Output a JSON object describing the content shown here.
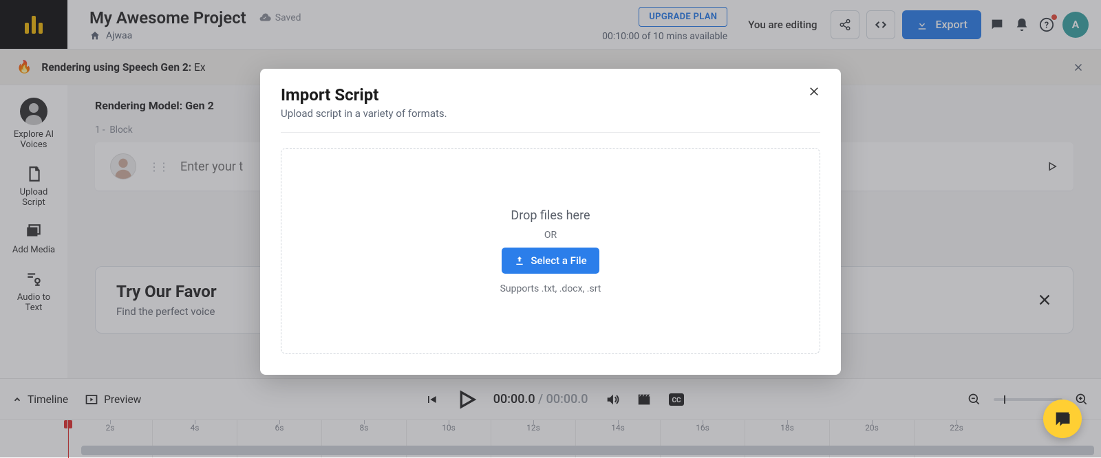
{
  "header": {
    "project_title": "My Awesome Project",
    "saved_label": "Saved",
    "home_label": "Ajwaa",
    "upgrade_label": "UPGRADE PLAN",
    "time_available": "00:10:00 of 10 mins available",
    "editing_label": "You are editing",
    "export_label": "Export",
    "avatar_letter": "A"
  },
  "banner": {
    "text_strong": "Rendering using Speech Gen 2:",
    "text_rest": " Ex"
  },
  "rail": {
    "explore": "Explore AI\nVoices",
    "upload": "Upload\nScript",
    "add_media": "Add Media",
    "audio_text": "Audio to\nText"
  },
  "main": {
    "model_label": "Rendering Model: Gen 2",
    "block_label_num": "1 -",
    "block_label_text": "Block",
    "input_placeholder": "Enter your t"
  },
  "favorites": {
    "title": "Try Our Favor",
    "subtitle": "Find the perfect voice"
  },
  "transport": {
    "timeline_label": "Timeline",
    "preview_label": "Preview",
    "time_current": "00:00.0",
    "time_sep": " / ",
    "time_total": "00:00.0",
    "ticks": [
      "2s",
      "4s",
      "6s",
      "8s",
      "10s",
      "12s",
      "14s",
      "16s",
      "18s",
      "20s",
      "22s"
    ]
  },
  "modal": {
    "title": "Import Script",
    "subtitle": "Upload script in a variety of formats.",
    "drop_title": "Drop files here",
    "or": "OR",
    "select_label": "Select a File",
    "supports": "Supports .txt, .docx, .srt"
  }
}
